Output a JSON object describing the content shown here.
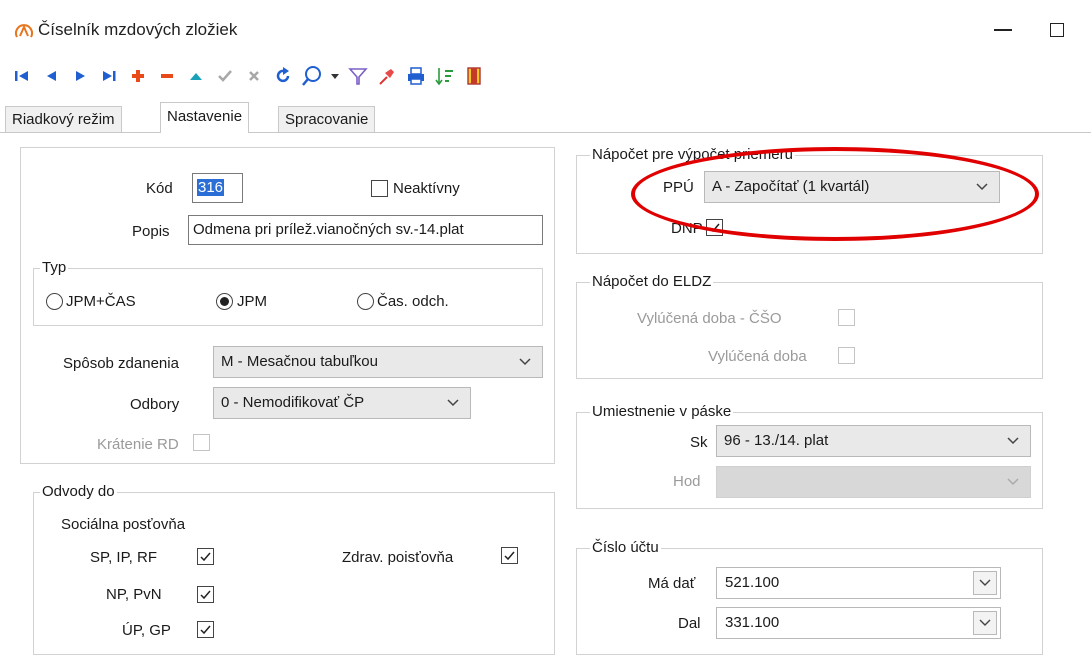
{
  "window": {
    "title": "Číselník mzdových zložiek",
    "logo_icon": "app-logo-icon"
  },
  "toolbar": {
    "icons": [
      "first-record-icon",
      "previous-record-icon",
      "next-record-icon",
      "last-record-icon",
      "add-icon",
      "delete-icon",
      "move-up-icon",
      "confirm-icon",
      "cancel-icon",
      "refresh-icon",
      "search-icon",
      "search-dropdown-icon",
      "filter-icon",
      "pin-icon",
      "print-icon",
      "sort-icon",
      "exit-icon"
    ]
  },
  "tabs": [
    {
      "label": "Riadkový režim",
      "active": false
    },
    {
      "label": "Nastavenie",
      "active": true
    },
    {
      "label": "Spracovanie",
      "active": false
    }
  ],
  "general": {
    "kod_label": "Kód",
    "kod_value": "316",
    "neaktivny_label": "Neaktívny",
    "neaktivny_checked": false,
    "popis_label": "Popis",
    "popis_value": "Odmena pri prílež.vianočných sv.-14.plat"
  },
  "typ": {
    "legend": "Typ",
    "options": [
      {
        "label": "JPM+ČAS",
        "selected": false
      },
      {
        "label": "JPM",
        "selected": true
      },
      {
        "label": "Čas. odch.",
        "selected": false
      }
    ]
  },
  "zdanenie": {
    "label": "Spôsob zdanenia",
    "value": "M - Mesačnou tabuľkou"
  },
  "odbory": {
    "label": "Odbory",
    "value": "0 - Nemodifikovať ČP"
  },
  "kratenie": {
    "label": "Krátenie RD",
    "checked": false
  },
  "odvody": {
    "legend": "Odvody do",
    "socialna_label": "Sociálna posťovňa",
    "items": [
      {
        "label": "SP, IP, RF",
        "checked": true
      },
      {
        "label": "NP, PvN",
        "checked": true
      },
      {
        "label": "ÚP, GP",
        "checked": true
      }
    ],
    "zdrav_label": "Zdrav. poisťovňa",
    "zdrav_checked": true
  },
  "napocet_priemer": {
    "legend": "Nápočet pre výpočet priemeru",
    "ppu_label": "PPÚ",
    "ppu_value": "A - Započítať (1 kvartál)",
    "dnp_label": "DNP",
    "dnp_checked": true
  },
  "napocet_eldz": {
    "legend": "Nápočet do ELDZ",
    "items": [
      {
        "label": "Vylúčená doba - ČŠO",
        "checked": false
      },
      {
        "label": "Vylúčená doba",
        "checked": false
      }
    ]
  },
  "umiestnenie": {
    "legend": "Umiestnenie v páske",
    "sk_label": "Sk",
    "sk_value": "96 - 13./14. plat",
    "hod_label": "Hod",
    "hod_value": ""
  },
  "cislo_uctu": {
    "legend": "Číslo účtu",
    "ma_dat_label": "Má dať",
    "ma_dat_value": "521.100",
    "dal_label": "Dal",
    "dal_value": "331.100"
  },
  "colors": {
    "highlight": "#e00000",
    "selection": "#2b6fd6"
  }
}
